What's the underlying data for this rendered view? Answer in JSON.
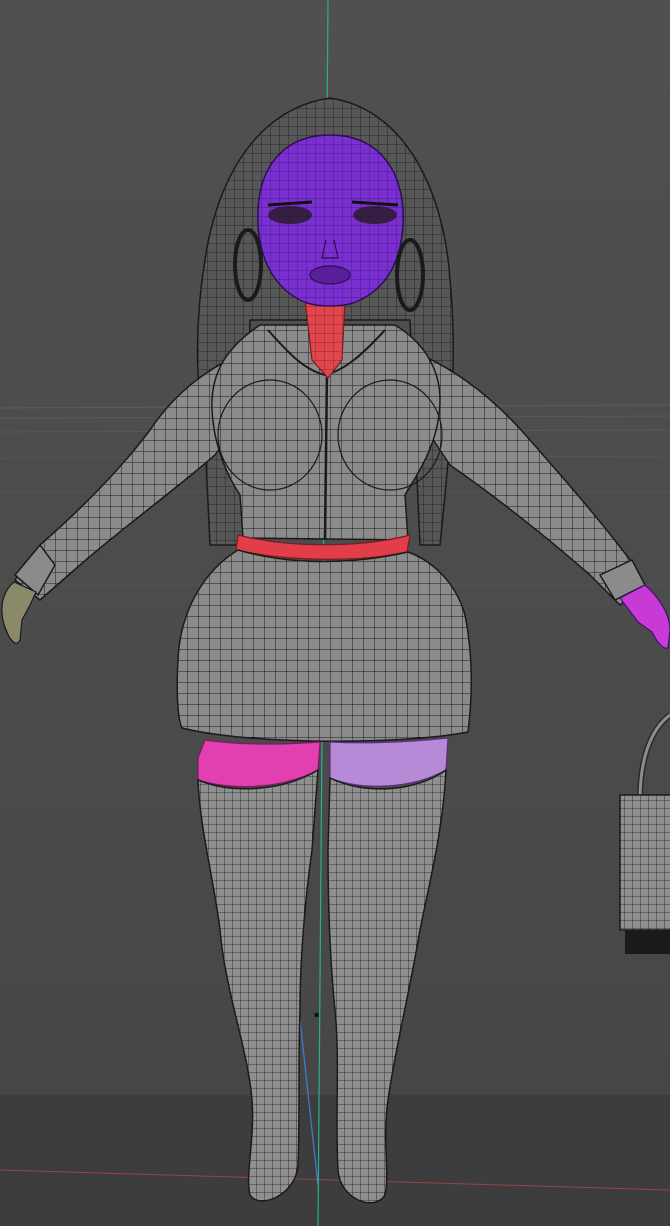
{
  "viewport": {
    "background": "#4a4a4a",
    "grid_color": "#5a5a5a",
    "axis_y_color": "#27b08f",
    "axis_x_color": "#c0484a",
    "axis_z_color": "#3f7dd8"
  },
  "model": {
    "wire_color": "#1b1b1b",
    "surface_color": "#8c8c8c",
    "head_color": "#7a2fd0",
    "neck_color": "#e0474c",
    "waistband_color": "#e23e4a",
    "thigh_left_color": "#e23fb0",
    "thigh_right_color": "#b68ad6",
    "hand_right_color": "#c83ad6",
    "hand_left_color": "#8a8a6a",
    "bag_color": "#7d7d7d"
  },
  "icons": {
    "pivot": "pivot-icon"
  }
}
